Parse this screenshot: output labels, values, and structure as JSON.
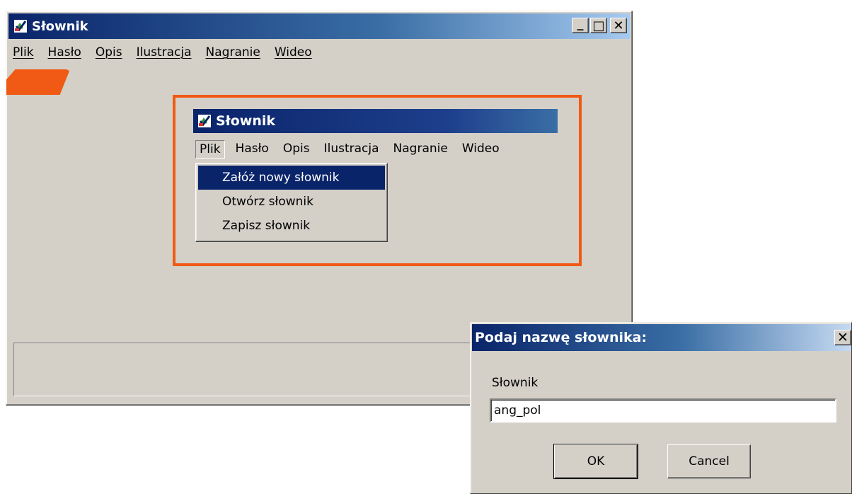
{
  "main_window": {
    "title": "Słownik",
    "caption_buttons": {
      "minimize": "_",
      "maximize": "□",
      "close": "✕"
    },
    "menu": [
      "Plik",
      "Hasło",
      "Opis",
      "Ilustracja",
      "Nagranie",
      "Wideo"
    ]
  },
  "inset": {
    "title": "Słownik",
    "menu": [
      "Plik",
      "Hasło",
      "Opis",
      "Ilustracja",
      "Nagranie",
      "Wideo"
    ],
    "dropdown": [
      "Załóż nowy słownik",
      "Otwórz słownik",
      "Zapisz słownik"
    ]
  },
  "dialog": {
    "title": "Podaj nazwę słownika:",
    "close": "✕",
    "label": "Słownik",
    "input_value": "ang_pol",
    "ok_label": "OK",
    "cancel_label": "Cancel"
  },
  "colors": {
    "accent_orange": "#f05a14",
    "title_blue": "#0a246a",
    "face": "#d4d0c8"
  },
  "icons": {
    "app": "dictionary-check-icon"
  }
}
